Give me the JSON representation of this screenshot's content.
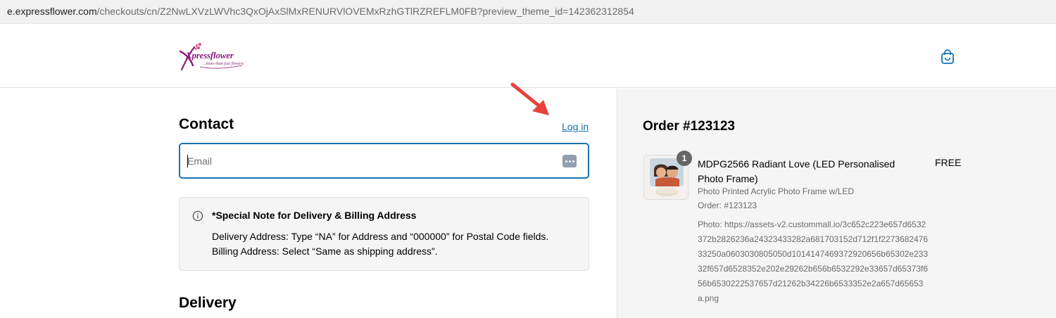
{
  "browser": {
    "url_host": "e.expressflower.com",
    "url_rest": "/checkouts/cn/Z2NwLXVzLWVhc3QxOjAxSlMxRENURVlOVEMxRzhGTlRZREFLM0FB?preview_theme_id=142362312854"
  },
  "header": {
    "logo_text": "Xpressflower",
    "logo_tagline": "...more than just flowers",
    "cart_icon": "shopping-bag-icon"
  },
  "contact": {
    "heading": "Contact",
    "login_label": "Log in",
    "email_placeholder": "Email",
    "email_value": ""
  },
  "special_note": {
    "icon": "info-icon",
    "title": "*Special Note for Delivery & Billing Address",
    "line1": "Delivery Address: Type “NA” for Address and “000000” for Postal Code fields.",
    "line2": "Billing Address: Select “Same as shipping address”."
  },
  "delivery": {
    "heading": "Delivery"
  },
  "order_summary": {
    "title": "Order #123123",
    "item": {
      "quantity": "1",
      "name": "MDPG2566 Radiant Love (LED Personalised Photo Frame)",
      "price": "FREE",
      "variant": "Photo Printed Acrylic Photo Frame w/LED",
      "order_ref": "Order: #123123",
      "photo": "Photo: https://assets-v2.custommall.io/3c652c223e657d6532372b2826236a24323433282a681703152d712f1f227368247633250a0603030805050d1014147469372920656b65302e23332f657d6528352e202e29262b656b6532292e33657d65373f656b6530222537657d21262b34226b6533352e2a657d65653a.png"
    }
  },
  "colors": {
    "accent": "#1773b0",
    "brand": "#8a1c7c",
    "annotation_arrow": "#e8423c",
    "summary_bg": "#f5f5f5"
  }
}
